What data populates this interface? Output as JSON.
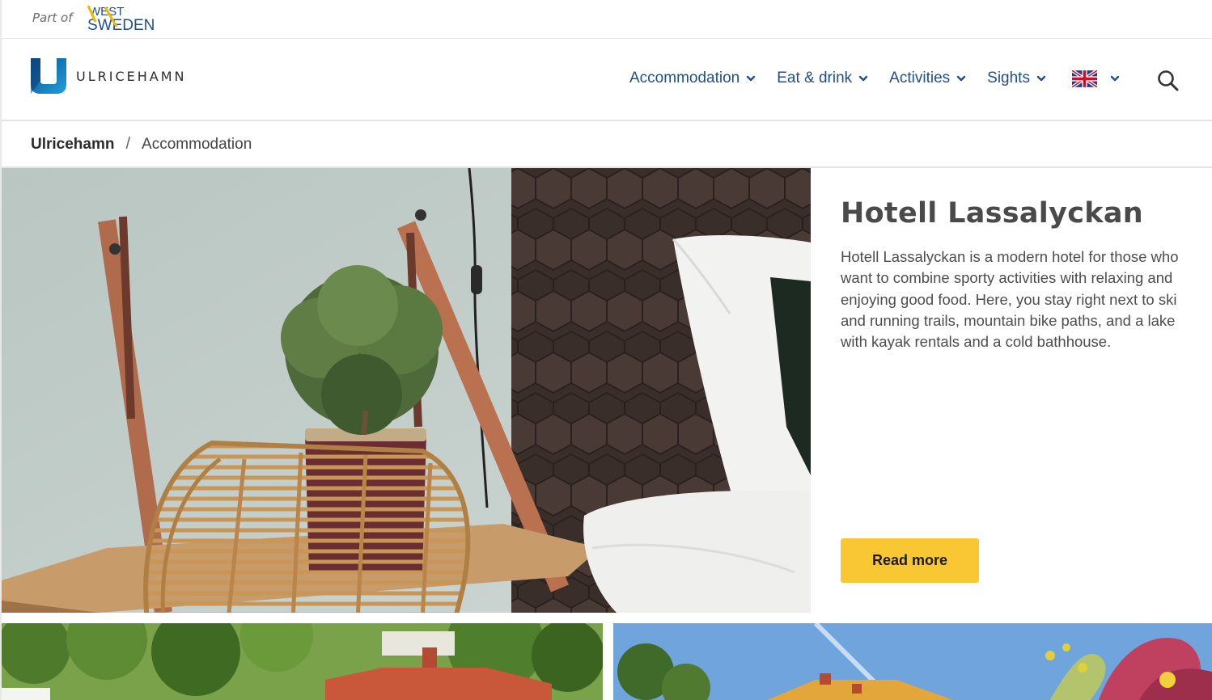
{
  "top_strip": {
    "part_of": "Part of",
    "west_sweden_logo": {
      "line1": "WEST",
      "line2": "SWEDEN"
    }
  },
  "logo": {
    "text": "ULRICEHAMN",
    "icon": "ulricehamn-u-logo"
  },
  "nav": {
    "items": [
      {
        "label": "Accommodation",
        "icon": "chevron-down-icon"
      },
      {
        "label": "Eat & drink",
        "icon": "chevron-down-icon"
      },
      {
        "label": "Activities",
        "icon": "chevron-down-icon"
      },
      {
        "label": "Sights",
        "icon": "chevron-down-icon"
      }
    ],
    "language": {
      "icon": "uk-flag-icon"
    },
    "search_icon": "search-icon"
  },
  "breadcrumb": {
    "home": "Ulricehamn",
    "separator": "/",
    "current": "Accommodation"
  },
  "hero": {
    "title": "Hotell Lassalyckan",
    "description": "Hotell Lassalyckan is a modern hotel for those who want to combine sporty activities with relaxing and enjoying good food. Here, you stay right next to ski and running trails, mountain bike paths, and a lake with kayak rentals and a cold bathhouse.",
    "button_label": "Read more",
    "image": "hotel-room-photo"
  },
  "cards": [
    {
      "image": "green-trees-house-photo"
    },
    {
      "image": "house-blue-sky-flowers-photo"
    }
  ],
  "colors": {
    "nav_link": "#1f4e8c",
    "button_bg": "#f8c733",
    "title": "#4a4a4a",
    "logo_blue": "#1a86c7"
  }
}
